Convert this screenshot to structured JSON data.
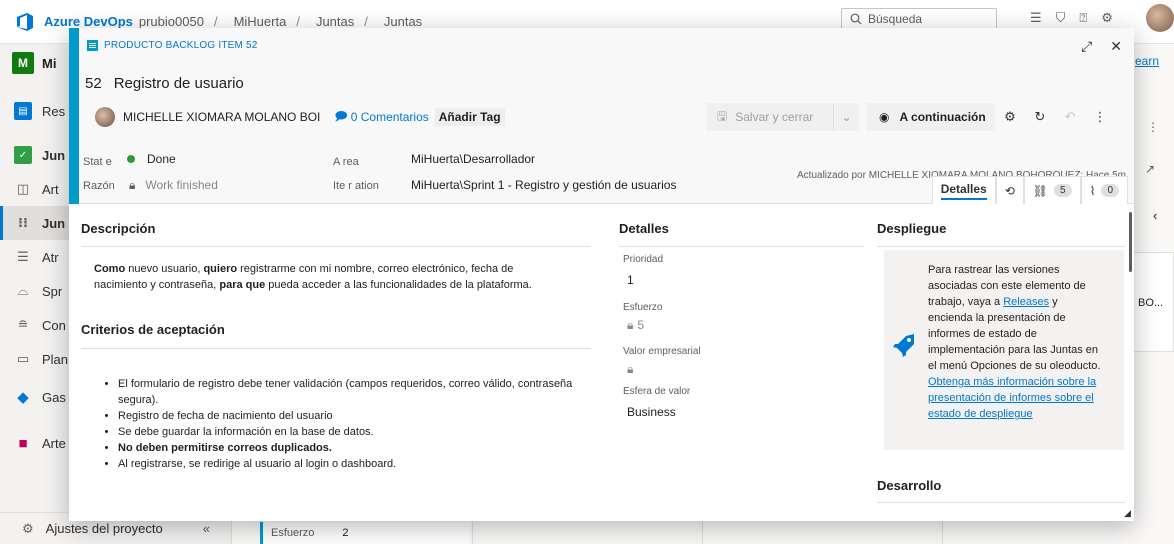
{
  "topbar": {
    "brand": "Azure DevOps",
    "crumbs": [
      "prubio0050",
      "MiHuerta",
      "Juntas",
      "Juntas"
    ],
    "search_placeholder": "Búsqueda"
  },
  "leftnav": {
    "project_badge": "M",
    "project_name": "Mi",
    "items": [
      {
        "label": "Res",
        "icon": "overview-icon"
      },
      {
        "label": "Jun",
        "icon": "boards-icon"
      },
      {
        "label": "Art",
        "icon": "work-items-icon"
      },
      {
        "label": "Jun",
        "icon": "juntas-icon"
      },
      {
        "label": "Atr",
        "icon": "backlog-icon"
      },
      {
        "label": "Spr",
        "icon": "sprints-icon"
      },
      {
        "label": "Con",
        "icon": "queries-icon"
      },
      {
        "label": "Plan",
        "icon": "plans-icon"
      },
      {
        "label": "Gas",
        "icon": "pipelines-icon"
      },
      {
        "label": "Arte",
        "icon": "artifacts-icon"
      }
    ],
    "settings_label": "Ajustes del proyecto",
    "collapse_glyph": "«"
  },
  "board": {
    "card_field_label": "Esfuerzo",
    "card_field_value": "2",
    "right_link": "earn",
    "right_card_text": "BO..."
  },
  "dialog": {
    "type_label": "PRODUCTO BACKLOG ITEM 52",
    "id": "52",
    "title": "Registro de usuario",
    "owner": "MICHELLE XIOMARA MOLANO BOI",
    "comments": "0 Comentarios",
    "add_tag": "Añadir Tag",
    "save_label": "Salvar y cerrar",
    "next_label": "A continuación",
    "state_label": "Stat e",
    "state_value": "Done",
    "reason_label": "Razón",
    "reason_value": "Work finished",
    "area_label": "A rea",
    "area_value": "MiHuerta\\Desarrollador",
    "iteration_label": "Ite r ation",
    "iteration_value": "MiHuerta\\Sprint 1 - Registro y gestión de usuarios",
    "updated": "Actualizado por MICHELLE XIOMARA MOLANO BOHORQUEZ: Hace 5m",
    "tabs": {
      "details": "Detalles",
      "links_count": "5",
      "attachments_count": "0"
    }
  },
  "description": {
    "header": "Descripción",
    "w1": "Como",
    "t1": " nuevo usuario, ",
    "w2": "quiero",
    "t2": " registrarme con mi nombre, correo electrónico, fecha de nacimiento y contraseña, ",
    "w3": "para que",
    "t3": " pueda acceder a las funcionalidades de la plataforma."
  },
  "criteria": {
    "header": "Criterios de aceptación",
    "items": [
      "El formulario de registro debe tener validación (campos requeridos, correo válido, contraseña segura).",
      "Registro de fecha de nacimiento del usuario",
      "Se debe guardar la información en la base de datos.",
      "No deben permitirse correos duplicados.",
      "Al registrarse, se redirige al usuario al login o dashboard."
    ]
  },
  "details": {
    "header": "Detalles",
    "priority_label": "Prioridad",
    "priority_value": "1",
    "effort_label": "Esfuerzo",
    "effort_value": "5",
    "business_value_label": "Valor empresarial",
    "value_area_label": "Esfera de valor",
    "value_area_value": "Business"
  },
  "deployment": {
    "header": "Despliegue",
    "p1": "Para rastrear las versiones asociadas con este elemento de trabajo, vaya a ",
    "releases_link": "Releases",
    "p2": " y encienda la presentación de informes de estado de implementación para las Juntas en el menú Opciones de su oleoducto. ",
    "more_link": "Obtenga más información sobre la presentación de informes sobre el estado de despliegue"
  },
  "development": {
    "header": "Desarrollo"
  }
}
